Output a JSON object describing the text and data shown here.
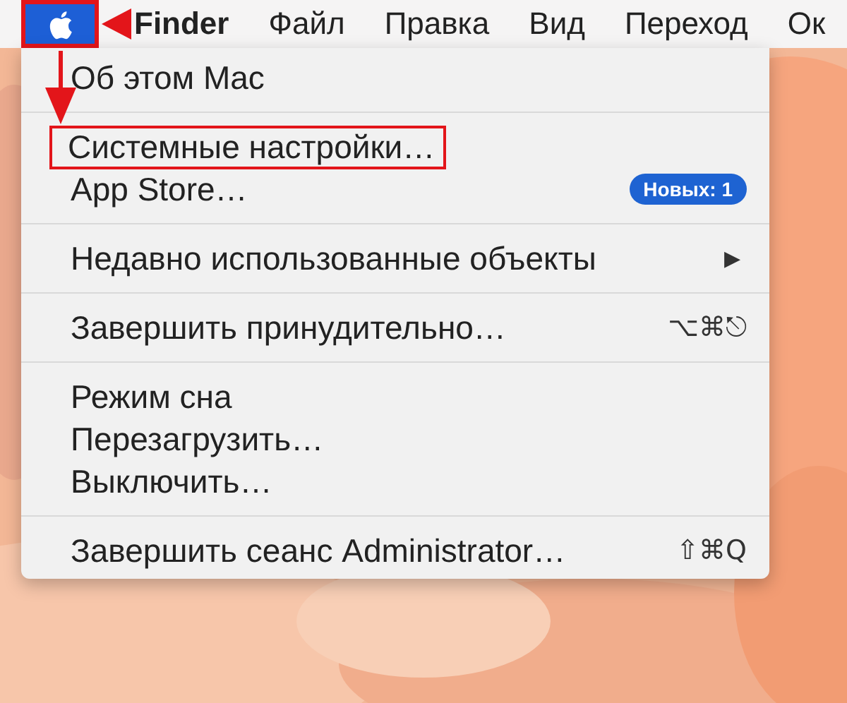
{
  "menubar": {
    "items": [
      {
        "kind": "apple",
        "selected": true,
        "marked": true
      },
      {
        "kind": "text",
        "label": "Finder",
        "bold": true,
        "selected": false,
        "marked": false
      },
      {
        "kind": "text",
        "label": "Файл",
        "bold": false,
        "selected": false,
        "marked": false
      },
      {
        "kind": "text",
        "label": "Правка",
        "bold": false,
        "selected": false,
        "marked": false
      },
      {
        "kind": "text",
        "label": "Вид",
        "bold": false,
        "selected": false,
        "marked": false
      },
      {
        "kind": "text",
        "label": "Переход",
        "bold": false,
        "selected": false,
        "marked": false
      },
      {
        "kind": "text",
        "label": "Ок",
        "bold": false,
        "selected": false,
        "marked": false
      }
    ]
  },
  "menu": {
    "items": [
      {
        "kind": "item",
        "label": "Об этом Mac",
        "marked": false
      },
      {
        "kind": "separator"
      },
      {
        "kind": "item",
        "label": "Системные настройки…",
        "marked": true
      },
      {
        "kind": "item",
        "label": "App Store…",
        "marked": false,
        "badge": "Новых: 1"
      },
      {
        "kind": "separator"
      },
      {
        "kind": "item",
        "label": "Недавно использованные объекты",
        "marked": false,
        "submenu": "▶"
      },
      {
        "kind": "separator"
      },
      {
        "kind": "item",
        "label": "Завершить принудительно…",
        "marked": false,
        "shortcut": "⌥⌘⎋"
      },
      {
        "kind": "separator"
      },
      {
        "kind": "item",
        "label": "Режим сна",
        "marked": false
      },
      {
        "kind": "item",
        "label": "Перезагрузить…",
        "marked": false
      },
      {
        "kind": "item",
        "label": "Выключить…",
        "marked": false
      },
      {
        "kind": "separator"
      },
      {
        "kind": "item",
        "label": "Завершить сеанс Administrator…",
        "marked": false,
        "shortcut": "⇧⌘Q"
      }
    ]
  }
}
